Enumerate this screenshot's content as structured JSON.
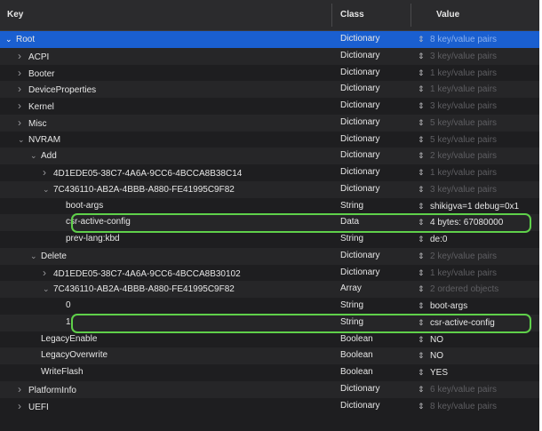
{
  "header": {
    "key": "Key",
    "class": "Class",
    "value": "Value"
  },
  "rows": [
    {
      "key": "Root",
      "indent": 0,
      "disclosure": "open",
      "class": "Dictionary",
      "value": "8 key/value pairs",
      "muted": true,
      "selected": true
    },
    {
      "key": "ACPI",
      "indent": 1,
      "disclosure": "closed",
      "class": "Dictionary",
      "value": "3 key/value pairs",
      "muted": true
    },
    {
      "key": "Booter",
      "indent": 1,
      "disclosure": "closed",
      "class": "Dictionary",
      "value": "1 key/value pairs",
      "muted": true
    },
    {
      "key": "DeviceProperties",
      "indent": 1,
      "disclosure": "closed",
      "class": "Dictionary",
      "value": "1 key/value pairs",
      "muted": true
    },
    {
      "key": "Kernel",
      "indent": 1,
      "disclosure": "closed",
      "class": "Dictionary",
      "value": "3 key/value pairs",
      "muted": true
    },
    {
      "key": "Misc",
      "indent": 1,
      "disclosure": "closed",
      "class": "Dictionary",
      "value": "5 key/value pairs",
      "muted": true
    },
    {
      "key": "NVRAM",
      "indent": 1,
      "disclosure": "open",
      "class": "Dictionary",
      "value": "5 key/value pairs",
      "muted": true
    },
    {
      "key": "Add",
      "indent": 2,
      "disclosure": "open",
      "class": "Dictionary",
      "value": "2 key/value pairs",
      "muted": true
    },
    {
      "key": "4D1EDE05-38C7-4A6A-9CC6-4BCCA8B38C14",
      "indent": 3,
      "disclosure": "closed",
      "class": "Dictionary",
      "value": "1 key/value pairs",
      "muted": true
    },
    {
      "key": "7C436110-AB2A-4BBB-A880-FE41995C9F82",
      "indent": 3,
      "disclosure": "open",
      "class": "Dictionary",
      "value": "3 key/value pairs",
      "muted": true
    },
    {
      "key": "boot-args",
      "indent": 4,
      "disclosure": "none",
      "class": "String",
      "value": "shikigva=1 debug=0x1",
      "muted": false
    },
    {
      "key": "csr-active-config",
      "indent": 4,
      "disclosure": "none",
      "class": "Data",
      "value": "4 bytes: 67080000",
      "muted": false,
      "highlight": true
    },
    {
      "key": "prev-lang:kbd",
      "indent": 4,
      "disclosure": "none",
      "class": "String",
      "value": "de:0",
      "muted": false
    },
    {
      "key": "Delete",
      "indent": 2,
      "disclosure": "open",
      "class": "Dictionary",
      "value": "2 key/value pairs",
      "muted": true
    },
    {
      "key": "4D1EDE05-38C7-4A6A-9CC6-4BCCA8B30102",
      "indent": 3,
      "disclosure": "closed",
      "class": "Dictionary",
      "value": "1 key/value pairs",
      "muted": true
    },
    {
      "key": "7C436110-AB2A-4BBB-A880-FE41995C9F82",
      "indent": 3,
      "disclosure": "open",
      "class": "Array",
      "value": "2 ordered objects",
      "muted": true
    },
    {
      "key": "0",
      "indent": 4,
      "disclosure": "none",
      "class": "String",
      "value": "boot-args",
      "muted": false
    },
    {
      "key": "1",
      "indent": 4,
      "disclosure": "none",
      "class": "String",
      "value": "csr-active-config",
      "muted": false,
      "highlight": true
    },
    {
      "key": "LegacyEnable",
      "indent": 2,
      "disclosure": "none",
      "class": "Boolean",
      "value": "NO",
      "muted": false
    },
    {
      "key": "LegacyOverwrite",
      "indent": 2,
      "disclosure": "none",
      "class": "Boolean",
      "value": "NO",
      "muted": false
    },
    {
      "key": "WriteFlash",
      "indent": 2,
      "disclosure": "none",
      "class": "Boolean",
      "value": "YES",
      "muted": false
    },
    {
      "key": "PlatformInfo",
      "indent": 1,
      "disclosure": "closed",
      "class": "Dictionary",
      "value": "6 key/value pairs",
      "muted": true
    },
    {
      "key": "UEFI",
      "indent": 1,
      "disclosure": "closed",
      "class": "Dictionary",
      "value": "8 key/value pairs",
      "muted": true
    }
  ],
  "icons": {
    "expanded": "chevron-down-icon",
    "collapsed": "chevron-right-icon",
    "stepper": "stepper-icon"
  },
  "colors": {
    "selection": "#1a5fd0",
    "highlight": "#5fd04a",
    "background": "#1e1e20",
    "muted_value": "#5e5e62"
  }
}
